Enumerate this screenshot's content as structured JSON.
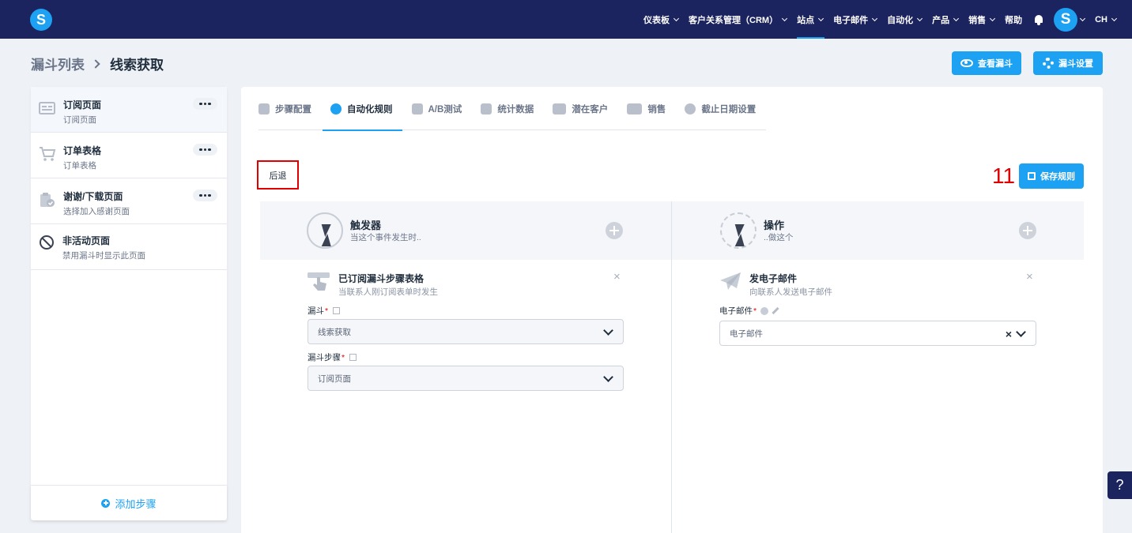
{
  "header": {
    "logo_letter": "S",
    "nav": [
      {
        "label": "仪表板",
        "chevron": true
      },
      {
        "label": "客户关系管理（CRM）",
        "chevron": true
      },
      {
        "label": "站点",
        "chevron": true,
        "active": true
      },
      {
        "label": "电子邮件",
        "chevron": true
      },
      {
        "label": "自动化",
        "chevron": true
      },
      {
        "label": "产品",
        "chevron": true
      },
      {
        "label": "销售",
        "chevron": true
      },
      {
        "label": "帮助",
        "chevron": false
      }
    ],
    "avatar_letter": "S",
    "lang": "CH"
  },
  "page": {
    "breadcrumb_parent": "漏斗列表",
    "breadcrumb_current": "线索获取",
    "view_funnel": "查看漏斗",
    "funnel_settings": "漏斗设置"
  },
  "sidebar": {
    "items": [
      {
        "title": "订阅页面",
        "subtitle": "订阅页面",
        "icon": "form-page-icon"
      },
      {
        "title": "订单表格",
        "subtitle": "订单表格",
        "icon": "cart-icon"
      },
      {
        "title": "谢谢/下载页面",
        "subtitle": "选择加入感谢页面",
        "icon": "clipboard-check-icon"
      },
      {
        "title": "非活动页面",
        "subtitle": "禁用漏斗时显示此页面",
        "icon": "ban-icon"
      }
    ],
    "add_step": "添加步骤"
  },
  "tabs": [
    {
      "label": "步骤配置"
    },
    {
      "label": "自动化规则",
      "active": true
    },
    {
      "label": "A/B测试"
    },
    {
      "label": "统计数据"
    },
    {
      "label": "潜在客户"
    },
    {
      "label": "销售"
    },
    {
      "label": "截止日期设置"
    }
  ],
  "rule": {
    "back": "后退",
    "step_number": "11",
    "save": "保存规则",
    "trigger": {
      "title": "触发器",
      "subtitle": "当这个事件发生时..",
      "card_title": "已订阅漏斗步骤表格",
      "card_subtitle": "当联系人刚订阅表单时发生",
      "funnel_label": "漏斗",
      "funnel_value": "线索获取",
      "step_label": "漏斗步骤",
      "step_value": "订阅页面"
    },
    "action": {
      "title": "操作",
      "subtitle": "..做这个",
      "card_title": "发电子邮件",
      "card_subtitle": "向联系人发送电子邮件",
      "email_label": "电子邮件",
      "email_placeholder": "电子邮件"
    }
  },
  "help_label": "?",
  "colors": {
    "nav_bg": "#1c2460",
    "accent": "#1da1f2",
    "highlight": "#e00000"
  }
}
